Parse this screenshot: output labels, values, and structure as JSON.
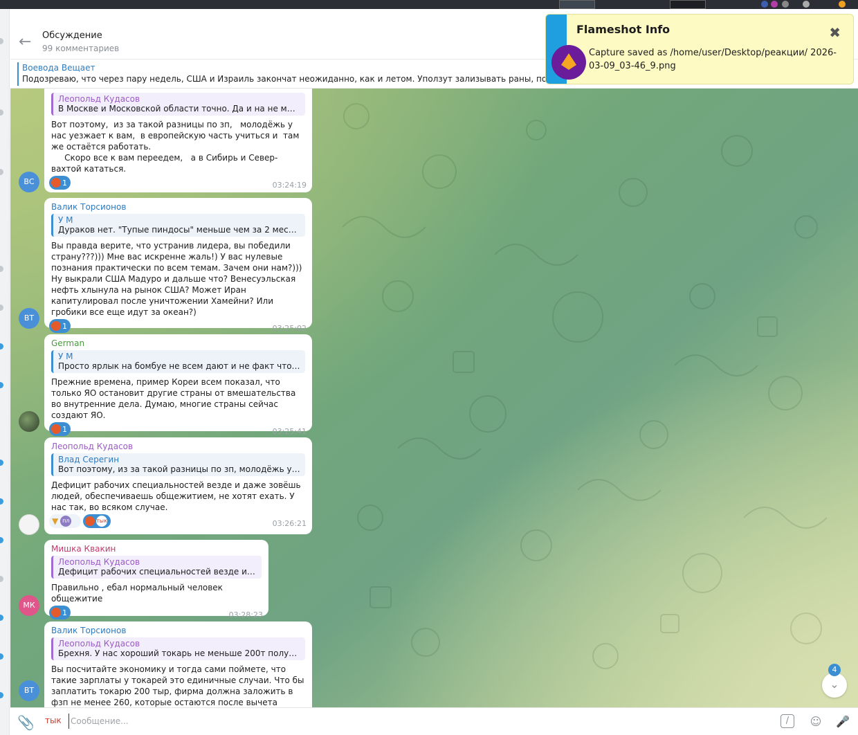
{
  "header": {
    "title": "Обсуждение",
    "subtitle": "99 комментариев"
  },
  "pinned": {
    "title": "Воевода Вещает",
    "text": "Подозреваю, что через пару недель, США и Израиль закончат неожиданно, как и летом. Уползут зализывать раны, попутно расс... что все цели SMO достигнуты, и вообще ничего особо то и не п..."
  },
  "messages": [
    {
      "quote_author": "Леопольд Кудасов",
      "quote_text": "В Москве и Московской области точно. Да и на не москов...",
      "body": "Вот поэтому,  из за такой разницы по зп,   молодёжь у нас уезжает к вам,  в европейскую часть учиться и  там же остаётся работать.\n     Скоро все к вам переедем,   а в Сибирь и Север- вахтой кататься.",
      "reaction_count": "1",
      "time": "03:24:19",
      "avatar": "ВС"
    },
    {
      "sender": "Валик Торсионов",
      "quote_author": "У М",
      "quote_text": "Дураков нет. \"Тупые пиндосы\" меньше чем за 2 месяца об...",
      "body": "Вы правда верите, что устранив лидера, вы победили страну???))) Мне вас искренне жаль!) У вас нулевые познания практически по всем темам. Зачем они нам?))) Ну выкрали США Мадуро и дальше что? Венесуэльская нефть хлынула на рынок США? Может Иран капитулировал после уничтожении Хамейни? Или гробики все еще идут за океан?)",
      "reaction_count": "1",
      "time": "03:25:02",
      "avatar": "ВТ"
    },
    {
      "sender": "German",
      "quote_author": "У М",
      "quote_text": "Просто ярлык на бомбуе не всем дают и не факт что она у...",
      "body": "Прежние времена, пример Кореи всем показал, что только ЯО остановит другие страны от вмешательства во внутренние дела. Думаю, многие страны сейчас создают ЯО.",
      "reaction_count": "1",
      "time": "03:25:41"
    },
    {
      "sender": "Леопольд Кудасов",
      "quote_author": "Влад Серегин",
      "quote_text": "Вот поэтому,  из за такой разницы по зп,   молодёжь у нас ...",
      "body": "Дефицит рабочих специальностей везде и даже зовёшь людей, обеспечиваешь общежитием, не хотят ехать. У нас так, во всяком случае.",
      "reaction_user_a": "пл",
      "reaction_user_b": "тык",
      "time": "03:26:21"
    },
    {
      "sender": "Мишка Квакин",
      "quote_author": "Леопольд Кудасов",
      "quote_text": "Дефицит рабочих специальностей везде и даж...",
      "body": "Правильно , ебал нормальный человек общежитие",
      "reaction_count": "1",
      "time": "03:28:23",
      "avatar": "МК"
    },
    {
      "sender": "Валик Торсионов",
      "quote_author": "Леопольд Кудасов",
      "quote_text": "Брехня. У нас хороший токарь не меньше 200т получает, ...",
      "body": "Вы посчитайте экономику и тогда сами поймете, что такие зарплаты у токарей это единичные случаи. Что бы заплатить токарю 200 тыр, фирма должна заложить в фзп не менее 260, которые остаются после вычета затрат на материалы, свет,",
      "avatar": "ВТ"
    }
  ],
  "input": {
    "typing_label": "тык",
    "placeholder": "Сообщение..."
  },
  "scroll": {
    "unread_count": "4"
  },
  "notification": {
    "title": "Flameshot Info",
    "text": "Capture saved as /home/user/Desktop/реакции/ 2026-03-09_03-46_9.png"
  },
  "colors": {
    "accent": "#3a8ed1",
    "sender_blue": "#2d7bc0",
    "sender_green": "#4a9a3e",
    "sender_purple": "#9b59c9",
    "sender_pink": "#c0396b",
    "avatar_vs": "#4a90d9",
    "avatar_vt": "#4a90d9",
    "avatar_mk": "#e0558a",
    "notification_bg": "#fdfbc3"
  },
  "icons": [
    "back-arrow-icon",
    "paperclip-icon",
    "command-icon",
    "emoji-icon",
    "microphone-icon",
    "chevron-down-icon",
    "close-icon",
    "flameshot-logo-icon",
    "reaction-emoji-icon"
  ]
}
